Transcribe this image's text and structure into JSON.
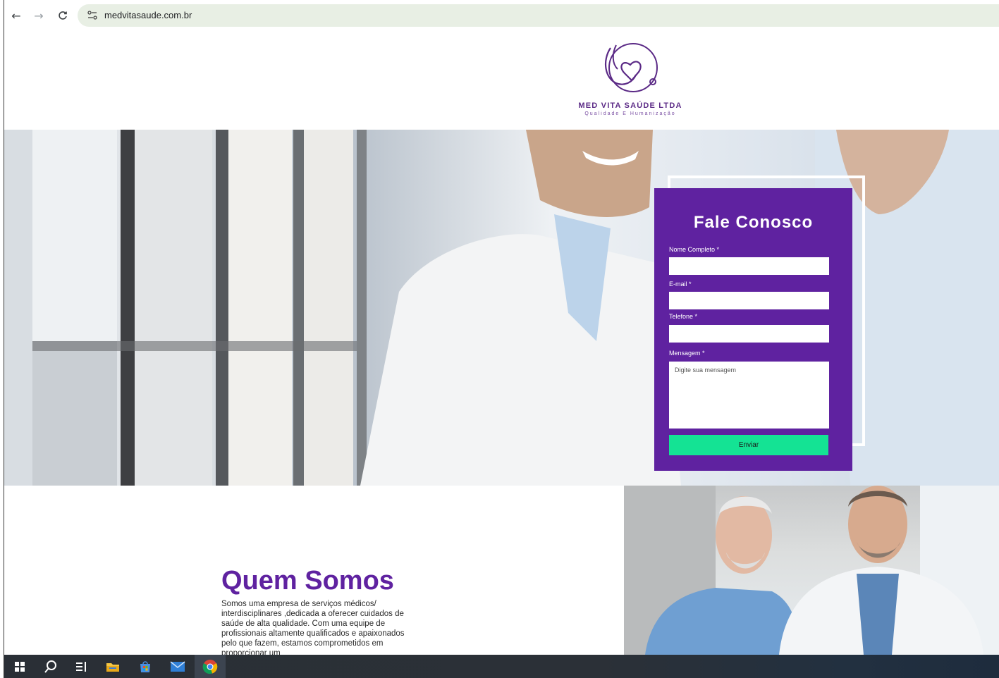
{
  "browser": {
    "url": "medvitasaude.com.br",
    "icons": [
      "back-arrow-icon",
      "forward-arrow-icon",
      "reload-icon",
      "site-info-icon"
    ]
  },
  "logo": {
    "title": "MED VITA SAÚDE LTDA",
    "tagline": "Qualidade E Humanização",
    "color": "#5b2a86"
  },
  "contact_form": {
    "title": "Fale Conosco",
    "fields": [
      {
        "label": "Nome Completo *",
        "value": ""
      },
      {
        "label": "E-mail *",
        "value": ""
      },
      {
        "label": "Telefone *",
        "value": ""
      }
    ],
    "message_label": "Mensagem *",
    "message_placeholder": "Digite sua mensagem",
    "submit_label": "Enviar",
    "background_color": "#5f22a0",
    "button_color": "#14e394"
  },
  "about": {
    "title": "Quem Somos",
    "text": "Somos uma empresa de serviços médicos/ interdisciplinares ,dedicada a oferecer cuidados de saúde de alta qualidade. Com uma equipe de profissionais altamente qualificados e apaixonados pelo que fazem, estamos comprometidos em proporcionar um"
  },
  "taskbar": {
    "items": [
      "windows-start-icon",
      "search-icon",
      "task-view-icon",
      "file-explorer-icon",
      "microsoft-store-icon",
      "mail-icon",
      "chrome-icon"
    ]
  }
}
